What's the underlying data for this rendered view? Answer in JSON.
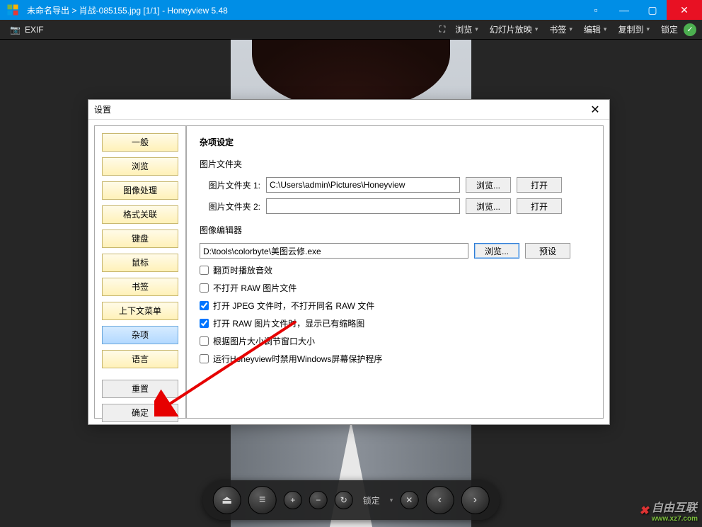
{
  "titlebar": {
    "title": "未命名导出  >  肖战-085155.jpg [1/1]  -  Honeyview 5.48"
  },
  "toolbar": {
    "exif": "EXIF",
    "items": [
      "浏览",
      "幻灯片放映",
      "书签",
      "编辑",
      "复制到",
      "锁定"
    ]
  },
  "player": {
    "lock": "锁定"
  },
  "dialog": {
    "title": "设置",
    "heading": "杂项设定",
    "tabs": [
      "一般",
      "浏览",
      "图像处理",
      "格式关联",
      "键盘",
      "鼠标",
      "书签",
      "上下文菜单",
      "杂项",
      "语言"
    ],
    "selected_tab": "杂项",
    "reset": "重置",
    "ok": "确定",
    "folders": {
      "section": "图片文件夹",
      "label1": "图片文件夹 1:",
      "value1": "C:\\Users\\admin\\Pictures\\Honeyview",
      "label2": "图片文件夹 2:",
      "value2": "",
      "browse": "浏览...",
      "open": "打开"
    },
    "editor": {
      "section": "图像编辑器",
      "value": "D:\\tools\\colorbyte\\美图云修.exe",
      "browse": "浏览...",
      "preset": "预设"
    },
    "checks": {
      "c1": "翻页时播放音效",
      "c2": "不打开 RAW 图片文件",
      "c3": "打开 JPEG 文件时，不打开同名 RAW 文件",
      "c4": "打开 RAW 图片文件时，显示已有缩略图",
      "c5": "根据图片大小调节窗口大小",
      "c6": "运行Honeyview时禁用Windows屏幕保护程序",
      "c3_checked": true,
      "c4_checked": true
    }
  },
  "watermark": {
    "text": "自由互联",
    "url": "www.xz7.com"
  }
}
